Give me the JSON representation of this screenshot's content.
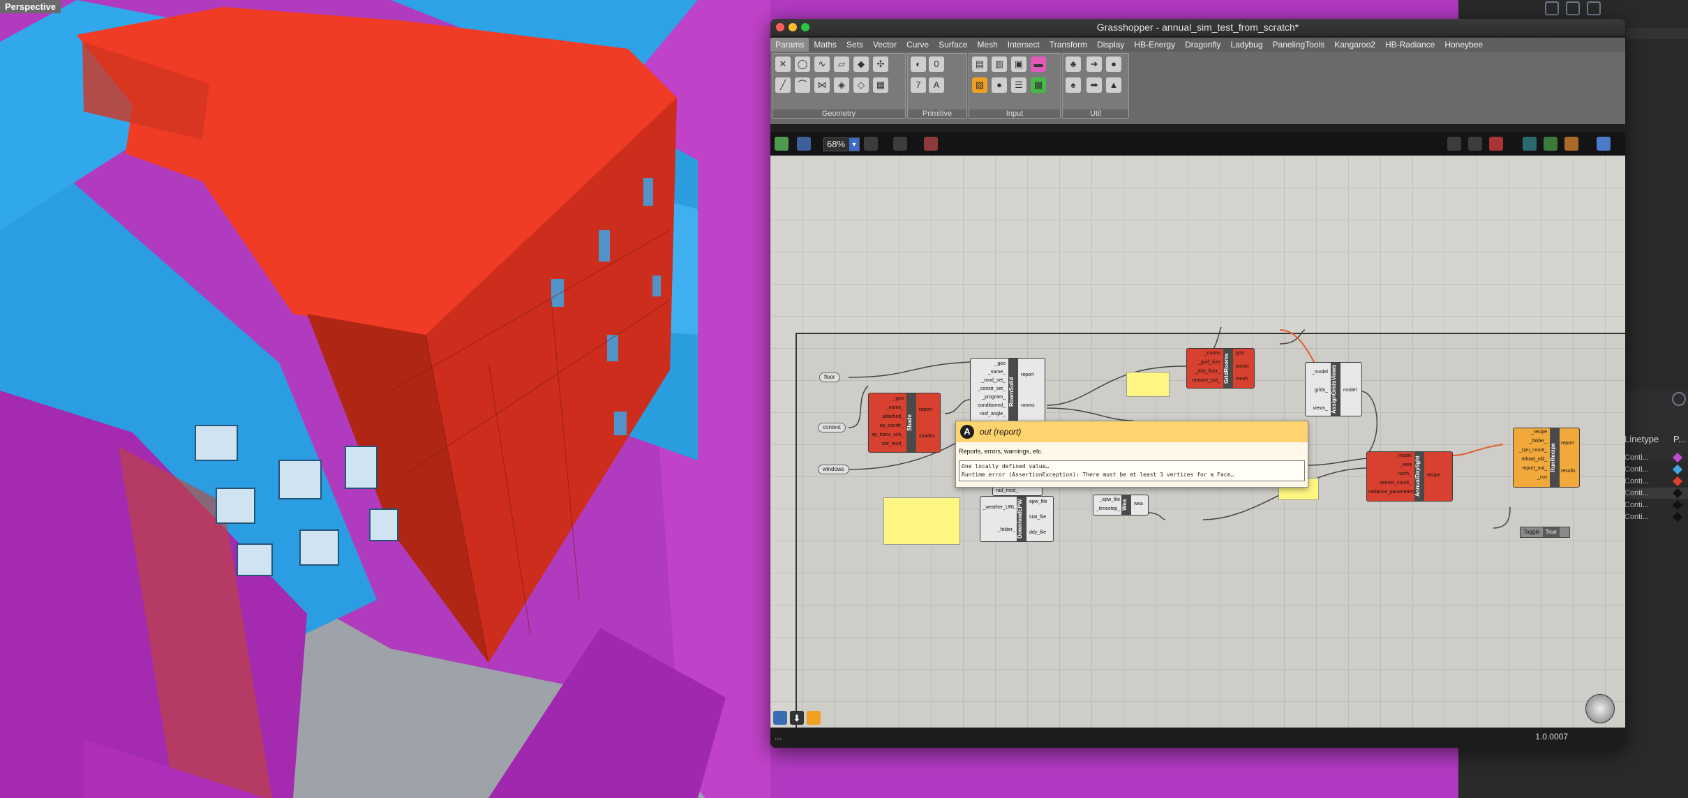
{
  "viewport": {
    "label": "Perspective"
  },
  "grasshopper": {
    "title": "Grasshopper - annual_sim_test_from_scratch*",
    "tabs": [
      "Params",
      "Maths",
      "Sets",
      "Vector",
      "Curve",
      "Surface",
      "Mesh",
      "Intersect",
      "Transform",
      "Display",
      "HB-Energy",
      "Dragonfly",
      "Ladybug",
      "PanelingTools",
      "Kangaroo2",
      "HB-Radiance",
      "Honeybee"
    ],
    "ribbon_groups": [
      "Geometry",
      "Primitive",
      "Input",
      "Util"
    ],
    "zoom": "68%",
    "version": "1.0.0007",
    "status_left": "...",
    "params": {
      "floor": "floor",
      "context": "context",
      "windows": "windows"
    },
    "shade": {
      "name": "Shade",
      "inputs": [
        "_geo",
        "_name_",
        "attached_",
        "ep_constr_",
        "ep_trans_sch_",
        "rad_mod_"
      ],
      "outputs": [
        "report",
        "shades"
      ]
    },
    "room_solid": {
      "name": "RoomSolid",
      "inputs": [
        "_geo",
        "_name_",
        "_mod_set_",
        "_constr_set_",
        "_program_",
        "conditioned_",
        "roof_angle_"
      ],
      "outputs": [
        "report",
        "rooms"
      ]
    },
    "grid_rooms": {
      "name": "GridRooms",
      "inputs": [
        "_rooms",
        "_grid_size",
        "_dist_floor_",
        "remove_out_"
      ],
      "outputs": [
        "grid",
        "points",
        "mesh"
      ]
    },
    "assign_grids": {
      "name": "AssignGridsViews",
      "inputs": [
        "_model",
        "grids_",
        "views_"
      ],
      "outputs": [
        "model"
      ]
    },
    "annual_daylight": {
      "name": "AnnualDaylight",
      "inputs": [
        "_model",
        "_wea",
        "north_",
        "sensor_count_",
        "radiance_parameters_"
      ],
      "outputs": [
        "recipe"
      ]
    },
    "run_recipe": {
      "name": "RunRecipe",
      "inputs": [
        "_recipe",
        "_folder_",
        "_cpu_count_",
        "reload_old_",
        "report_out_",
        "_run"
      ],
      "outputs": [
        "report",
        "results"
      ]
    },
    "download_epw": {
      "name": "DownloadEPW",
      "inputs": [
        "_weather_URL",
        "_folder_"
      ],
      "outputs": [
        "epw_file",
        "stat_file",
        "ddy_file"
      ]
    },
    "wea": {
      "name": "Wea",
      "inputs": [
        "_epw_file",
        "_timestep_"
      ],
      "outputs": [
        "wea"
      ]
    },
    "rad_mod_label": "rad_mod_",
    "toggle": {
      "label": "Toggle",
      "value": "True"
    },
    "tooltip": {
      "title": "out (report)",
      "icon_letter": "A",
      "description": "Reports, errors, warnings, etc.",
      "error_line1": "One locally defined value…",
      "error_line2": "Runtime error (AssertionException): There must be at least 3 vertices for a Face…"
    }
  },
  "layers_panel": {
    "header": "Linetype",
    "header2": "P...",
    "rows": [
      {
        "text": "Conti...",
        "color": "#c04ad0"
      },
      {
        "text": "Conti...",
        "color": "#3ea8e8"
      },
      {
        "text": "Conti...",
        "color": "#e04030"
      },
      {
        "text": "Conti...",
        "color": "#111111"
      },
      {
        "text": "Conti...",
        "color": "#111111"
      },
      {
        "text": "Conti...",
        "color": "#111111"
      }
    ]
  }
}
